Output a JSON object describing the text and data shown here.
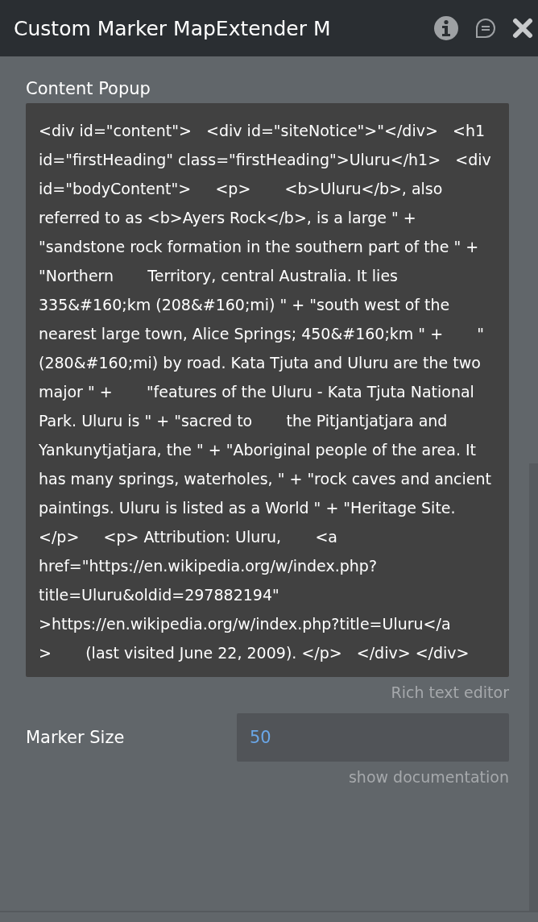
{
  "window": {
    "title": "Custom Marker MapExtender M"
  },
  "content_popup": {
    "label": "Content Popup",
    "value": "<div id=\"content\">   <div id=\"siteNotice\">\"</div>   <h1 id=\"firstHeading\" class=\"firstHeading\">Uluru</h1>   <div id=\"bodyContent\">     <p>       <b>Uluru</b>, also referred to as <b>Ayers Rock</b>, is a large \" + \"sandstone rock formation in the southern part of the \" + \"Northern       Territory, central Australia. It lies 335&#160;km (208&#160;mi) \" + \"south west of the nearest large town, Alice Springs; 450&#160;km \" +       \"(280&#160;mi) by road. Kata Tjuta and Uluru are the two major \" +       \"features of the Uluru - Kata Tjuta National Park. Uluru is \" + \"sacred to       the Pitjantjatjara and Yankunytjatjara, the \" + \"Aboriginal people of the area. It has many springs, waterholes, \" + \"rock caves and ancient       paintings. Uluru is listed as a World \" + \"Heritage Site.     </p>     <p> Attribution: Uluru,       <a href=\"https://en.wikipedia.org/w/index.php?title=Uluru&oldid=297882194\" >https://en.wikipedia.org/w/index.php?title=Uluru</a       >       (last visited June 22, 2009). </p>   </div> </div>",
    "editor_link": "Rich text editor"
  },
  "marker_size": {
    "label": "Marker Size",
    "value": "50"
  },
  "documentation_link": "show documentation"
}
